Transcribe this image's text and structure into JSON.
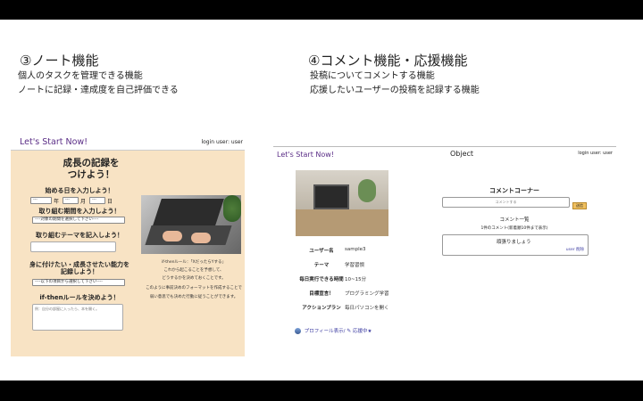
{
  "sections": [
    {
      "title": "③ノート機能",
      "desc": [
        "個人のタスクを管理できる機能",
        "ノートに記録・達成度を自己評価できる"
      ]
    },
    {
      "title": "④コメント機能・応援機能",
      "desc": [
        "投稿についてコメントする機能",
        "応援したいユーザーの投稿を記録する機能"
      ]
    }
  ],
  "left_mock": {
    "brand": "Let's Start Now!",
    "login": "login user: user",
    "title_line1": "成長の記録を",
    "title_line2": "つけよう！",
    "start_date_label": "始める日を入力しよう！",
    "date_sel_placeholder": "---",
    "unit_year": "年",
    "unit_month": "月",
    "unit_day": "日",
    "period_label": "取り組む期間を入力しよう！",
    "period_placeholder": "----対象の期間を選択して下さい----",
    "theme_label": "取り組むテーマを記入しよう！",
    "skill_label_line1": "身に付けたい・成長させたい能力を",
    "skill_label_line2": "記録しよう！",
    "skill_placeholder": "----以下の項目から選択して下さい----",
    "ifthen_label": "if-thenルールを決めよう！",
    "ifthen_placeholder": "例：自分の部屋に入ったら、本を開く。",
    "notes": [
      "if-thenルール：「XだったらYする」",
      "これから起こることを予想して、",
      "どうするかを決めておくことです。",
      "このように事前決めのフォーマットを作成することで",
      "弱い意思でも決めた行動に従うことができます。"
    ]
  },
  "right_mock": {
    "brand": "Let's Start Now!",
    "object": "Object",
    "login": "login user: user",
    "profile": [
      {
        "key": "ユーザー名",
        "value": "sample3"
      },
      {
        "key": "テーマ",
        "value": "学習習慣"
      },
      {
        "key": "毎日実行できる時間",
        "value": "10~15分"
      },
      {
        "key": "目標宣言！",
        "value": "プログラミング学習"
      },
      {
        "key": "アクションプラン",
        "value": "毎日パソコンを開く"
      }
    ],
    "profile_link": "プロフィール表示/",
    "cheer_link": "応援中★",
    "comment_title": "コメントコーナー",
    "comment_placeholder": "コメントする",
    "send_label": "送信",
    "comment_list_label": "コメント一覧",
    "comment_count": "1件のコメント(新着順10件まで表示)",
    "comment_text": "頑張りましょう",
    "comment_user": "user 削除"
  }
}
